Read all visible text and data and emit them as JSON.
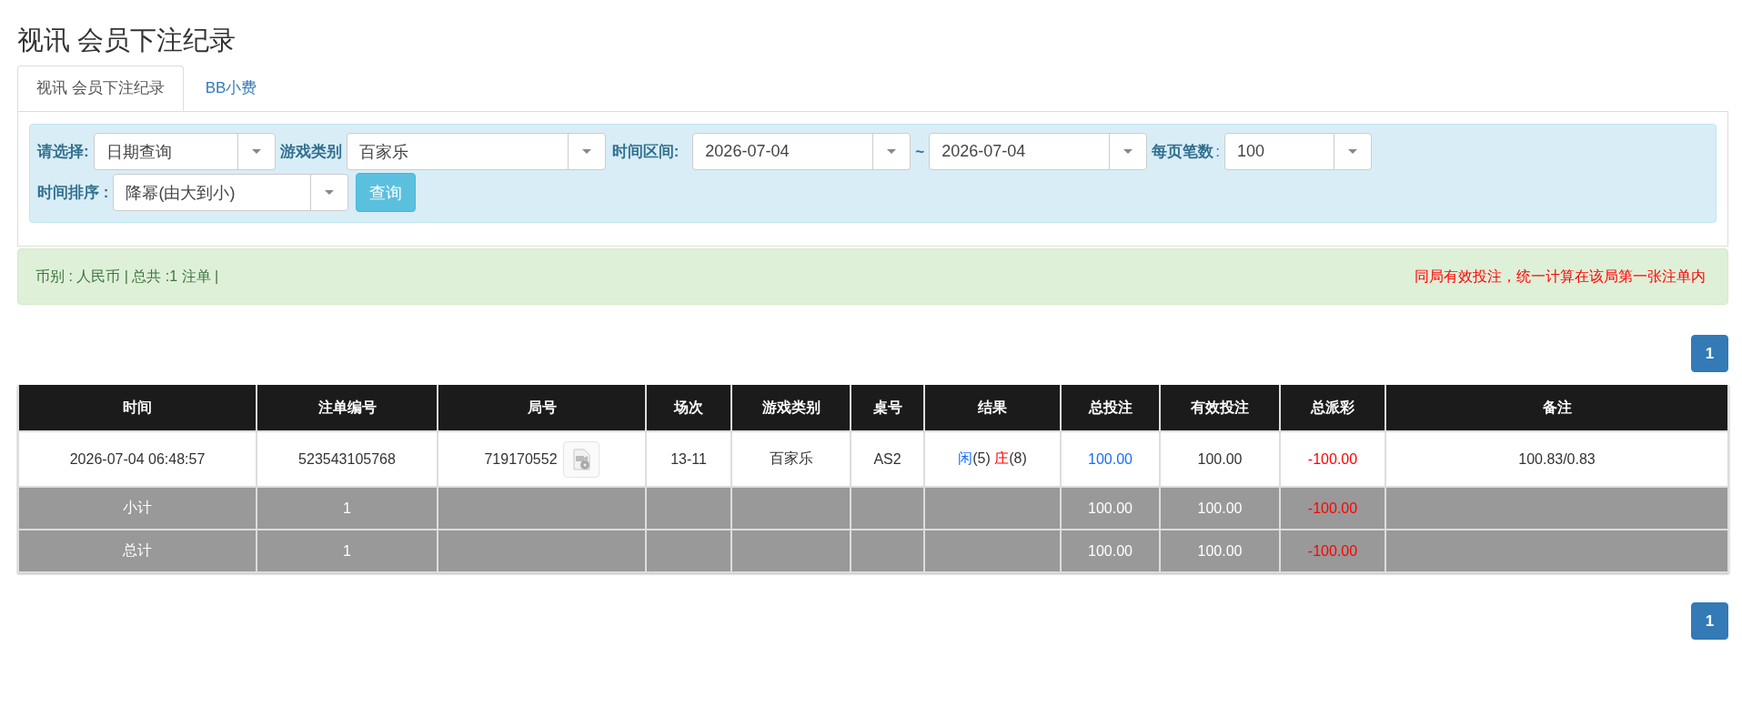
{
  "page_title": "视讯 会员下注纪录",
  "tabs": [
    {
      "label": "视讯 会员下注纪录",
      "selected": true
    },
    {
      "label": "BB小费",
      "selected": false
    }
  ],
  "filters": {
    "mode": {
      "label": "请选择:",
      "value": "日期查询"
    },
    "game": {
      "label": "游戏类别",
      "value": "百家乐"
    },
    "range": {
      "label": "时间区间:",
      "from": "2026-07-04",
      "sep": "~",
      "to": "2026-07-04"
    },
    "per_page": {
      "label": "每页笔数",
      "colon": ":",
      "value": "100"
    },
    "sort": {
      "label": "时间排序 :",
      "value": "降幂(由大到小)"
    },
    "query_button": "查询"
  },
  "summary": {
    "text": "币别 : 人民币 | 总共 :1 注单 |",
    "notice": "同局有效投注，统一计算在该局第一张注单内"
  },
  "pagination_top": [
    {
      "label": "1",
      "selected": true
    }
  ],
  "table": {
    "columns": [
      "时间",
      "注单编号",
      "局号",
      "场次",
      "游戏类别",
      "桌号",
      "结果",
      "总投注",
      "有效投注",
      "总派彩",
      "备注"
    ],
    "rows": [
      {
        "kind": "data",
        "cells": [
          {
            "kind": "plain",
            "text": "2026-07-04 06:48:57"
          },
          {
            "kind": "plain",
            "text": "523543105768"
          },
          {
            "kind": "round",
            "text": "719170552"
          },
          {
            "kind": "plain",
            "text": "13-11"
          },
          {
            "kind": "plain",
            "text": "百家乐"
          },
          {
            "kind": "plain",
            "text": "AS2"
          },
          {
            "kind": "result",
            "parts": [
              {
                "side": "闲",
                "score": "(5)",
                "color": "#1a6bff"
              },
              {
                "side": "庄",
                "score": "(8)",
                "color": "#ff0000"
              }
            ]
          },
          {
            "kind": "bet",
            "text": "100.00"
          },
          {
            "kind": "plain",
            "text": "100.00"
          },
          {
            "kind": "payout",
            "text": "-100.00"
          },
          {
            "kind": "plain",
            "text": "100.83/0.83"
          }
        ]
      },
      {
        "kind": "sum",
        "cells": [
          {
            "kind": "plain",
            "text": "小计"
          },
          {
            "kind": "plain",
            "text": "1"
          },
          {
            "kind": "empty"
          },
          {
            "kind": "empty"
          },
          {
            "kind": "empty"
          },
          {
            "kind": "empty"
          },
          {
            "kind": "empty"
          },
          {
            "kind": "plain",
            "text": "100.00"
          },
          {
            "kind": "plain",
            "text": "100.00"
          },
          {
            "kind": "payout",
            "text": "-100.00"
          },
          {
            "kind": "empty"
          }
        ]
      },
      {
        "kind": "sum",
        "cells": [
          {
            "kind": "plain",
            "text": "总计"
          },
          {
            "kind": "plain",
            "text": "1"
          },
          {
            "kind": "empty"
          },
          {
            "kind": "empty"
          },
          {
            "kind": "empty"
          },
          {
            "kind": "empty"
          },
          {
            "kind": "empty"
          },
          {
            "kind": "plain",
            "text": "100.00"
          },
          {
            "kind": "plain",
            "text": "100.00"
          },
          {
            "kind": "payout",
            "text": "-100.00"
          },
          {
            "kind": "empty"
          }
        ]
      }
    ]
  },
  "pagination_bottom": [
    {
      "label": "1",
      "selected": true
    }
  ]
}
